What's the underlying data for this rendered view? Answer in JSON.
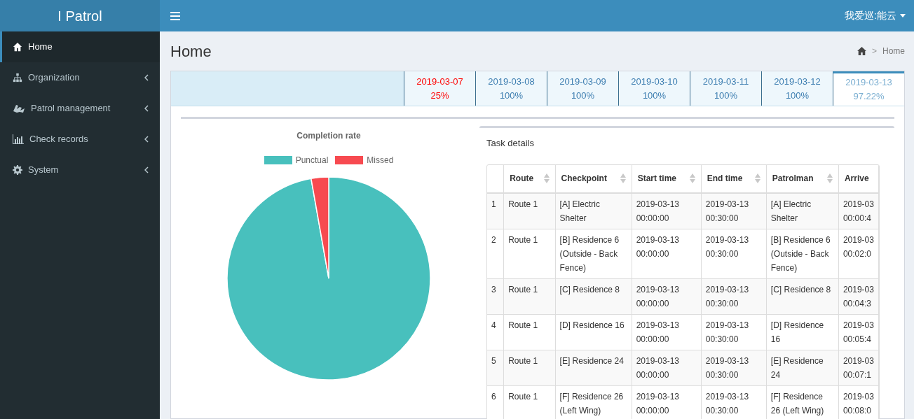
{
  "brand": "I Patrol",
  "user": "我爱巡:能云",
  "sidebar": {
    "items": [
      {
        "label": "Home",
        "kind": "home",
        "selected": true,
        "has_children": false
      },
      {
        "label": "Organization",
        "kind": "sitemap",
        "selected": false,
        "has_children": true
      },
      {
        "label": "Patrol management",
        "kind": "patrol",
        "selected": false,
        "has_children": true
      },
      {
        "label": "Check records",
        "kind": "chart",
        "selected": false,
        "has_children": true
      },
      {
        "label": "System",
        "kind": "gear",
        "selected": false,
        "has_children": true
      }
    ]
  },
  "page_title": "Home",
  "breadcrumb_separator": ">",
  "breadcrumb": [
    "Home"
  ],
  "date_tabs": [
    {
      "date": "2019-03-07",
      "rate": "25%",
      "warning": true,
      "selected": false
    },
    {
      "date": "2019-03-08",
      "rate": "100%",
      "warning": false,
      "selected": false
    },
    {
      "date": "2019-03-09",
      "rate": "100%",
      "warning": false,
      "selected": false
    },
    {
      "date": "2019-03-10",
      "rate": "100%",
      "warning": false,
      "selected": false
    },
    {
      "date": "2019-03-11",
      "rate": "100%",
      "warning": false,
      "selected": false
    },
    {
      "date": "2019-03-12",
      "rate": "100%",
      "warning": false,
      "selected": false
    },
    {
      "date": "2019-03-13",
      "rate": "97.22%",
      "warning": false,
      "selected": true
    }
  ],
  "chart": {
    "chart_data": {
      "type": "pie",
      "title": "Completion rate",
      "categories": [
        "Punctual",
        "Missed"
      ],
      "values": [
        97.22,
        2.78
      ],
      "colors": [
        "#48c0bd",
        "#f74a50"
      ]
    }
  },
  "task_details": {
    "title": "Task details",
    "columns": [
      "",
      "Route",
      "Checkpoint",
      "Start time",
      "End time",
      "Patrolman",
      "Arrive"
    ],
    "rows": [
      [
        "1",
        "Route 1",
        "[A] Electric Shelter",
        "2019-03-13 00:00:00",
        "2019-03-13 00:30:00",
        "[A] Electric Shelter",
        "2019-03 00:00:4"
      ],
      [
        "2",
        "Route 1",
        "[B] Residence 6 (Outside - Back Fence)",
        "2019-03-13 00:00:00",
        "2019-03-13 00:30:00",
        "[B] Residence 6 (Outside - Back Fence)",
        "2019-03 00:02:0"
      ],
      [
        "3",
        "Route 1",
        "[C] Residence 8",
        "2019-03-13 00:00:00",
        "2019-03-13 00:30:00",
        "[C] Residence 8",
        "2019-03 00:04:3"
      ],
      [
        "4",
        "Route 1",
        "[D] Residence 16",
        "2019-03-13 00:00:00",
        "2019-03-13 00:30:00",
        "[D] Residence 16",
        "2019-03 00:05:4"
      ],
      [
        "5",
        "Route 1",
        "[E] Residence 24",
        "2019-03-13 00:00:00",
        "2019-03-13 00:30:00",
        "[E] Residence 24",
        "2019-03 00:07:1"
      ],
      [
        "6",
        "Route 1",
        "[F] Residence 26 (Left Wing)",
        "2019-03-13 00:00:00",
        "2019-03-13 00:30:00",
        "[F] Residence 26 (Left Wing)",
        "2019-03 00:08:0"
      ]
    ]
  }
}
